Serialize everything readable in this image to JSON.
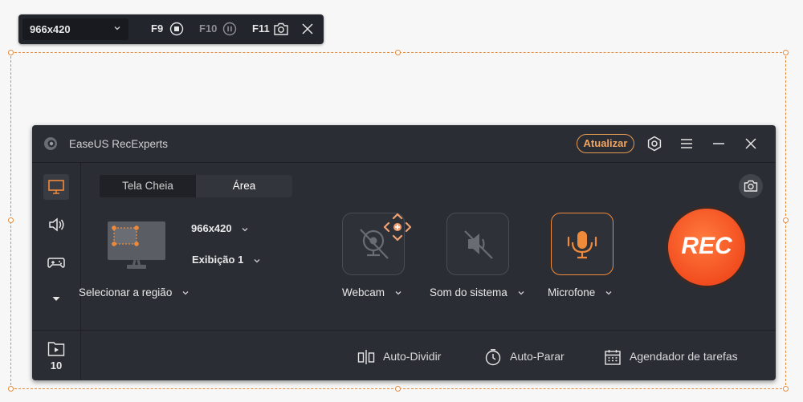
{
  "toolbar": {
    "resolution": "966x420",
    "keys": {
      "stop": "F9",
      "pause": "F10",
      "screenshot": "F11"
    }
  },
  "app": {
    "title": "EaseUS RecExperts",
    "upgrade_label": "Atualizar",
    "recordings_count": "10"
  },
  "tabs": {
    "full_screen": "Tela Cheia",
    "area": "Área"
  },
  "area": {
    "resolution": "966x420",
    "display": "Exibição 1",
    "select_region": "Selecionar a região"
  },
  "sources": {
    "webcam": "Webcam",
    "system_sound": "Som do sistema",
    "microphone": "Microfone"
  },
  "rec_label": "REC",
  "bottom": {
    "auto_split": "Auto-Dividir",
    "auto_stop": "Auto-Parar",
    "scheduler": "Agendador de tarefas"
  },
  "colors": {
    "accent": "#ef8a3a",
    "rec": "#f24d1f",
    "panel": "#2b2d34"
  }
}
